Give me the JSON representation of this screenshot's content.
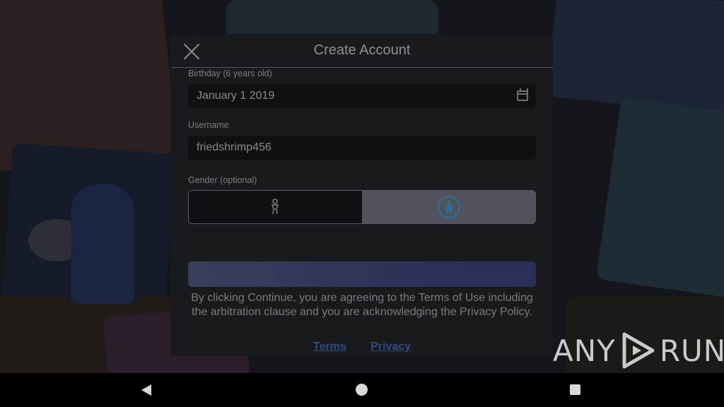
{
  "modal": {
    "title": "Create Account",
    "birthday": {
      "label": "Birthday (6 years old)",
      "value": "January 1 2019"
    },
    "username": {
      "label": "Username",
      "value": "friedshrimp456"
    },
    "gender": {
      "label": "Gender (optional)",
      "selected": "female"
    },
    "continue_label": "",
    "legal_text": "By clicking Continue, you are agreeing to the Terms of Use including the arbitration clause and you are acknowledging the Privacy Policy.",
    "links": {
      "terms": "Terms",
      "privacy": "Privacy"
    }
  },
  "watermark": {
    "left": "ANY",
    "right": "RUN"
  },
  "colors": {
    "accent": "#2d4d7b",
    "selected_gender_bg": "#50535b",
    "icon_blue": "#2f6f96"
  },
  "icons": [
    "close-icon",
    "calendar-icon",
    "male-icon",
    "female-icon",
    "back-icon",
    "home-icon",
    "recents-icon"
  ]
}
